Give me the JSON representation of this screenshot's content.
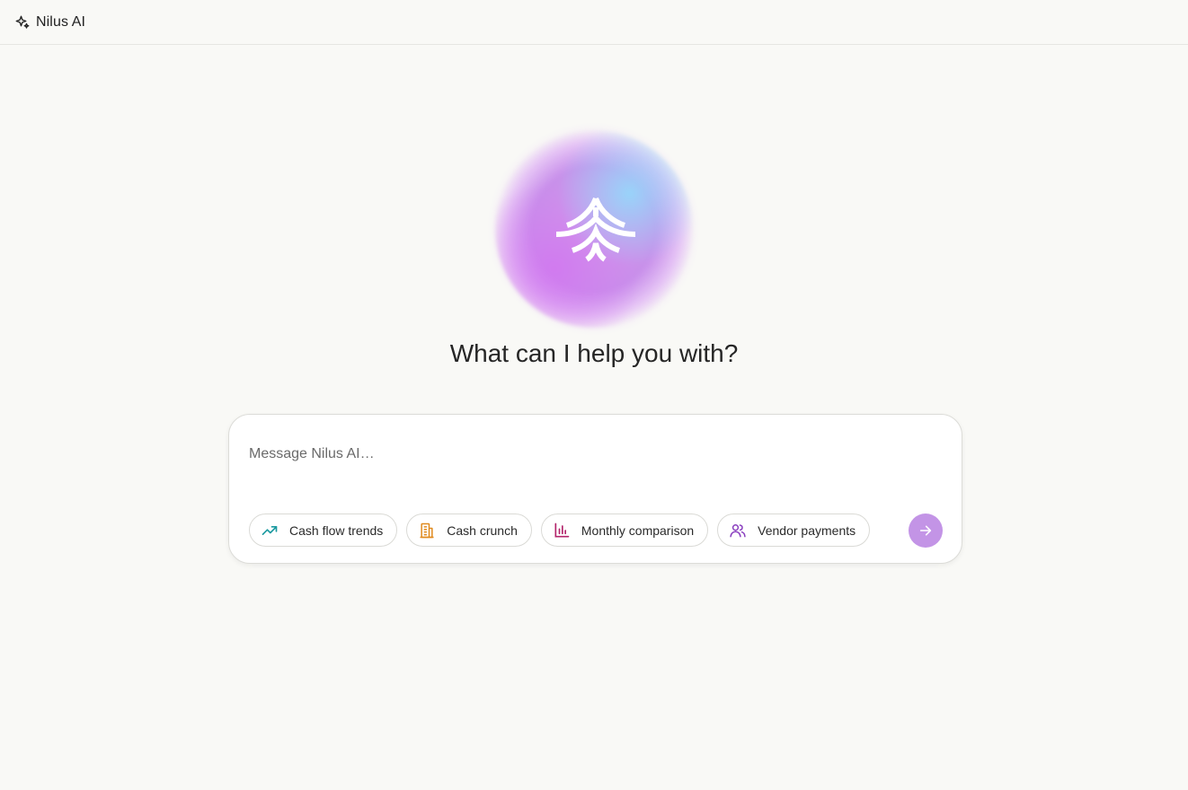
{
  "header": {
    "brand_name": "Nilus AI",
    "brand_icon": "sparkle-icon"
  },
  "hero": {
    "logo_icon": "nilus-logo-icon",
    "headline": "What can I help you with?"
  },
  "composer": {
    "placeholder": "Message Nilus AI…",
    "value": "",
    "suggestions": [
      {
        "label": "Cash flow trends",
        "icon": "trending-up-icon",
        "color": "#1b9aa0"
      },
      {
        "label": "Cash crunch",
        "icon": "building-icon",
        "color": "#e08a1e"
      },
      {
        "label": "Monthly comparison",
        "icon": "bar-chart-icon",
        "color": "#b3246b"
      },
      {
        "label": "Vendor payments",
        "icon": "users-icon",
        "color": "#8a3fbf"
      }
    ],
    "send_icon": "arrow-right-icon"
  },
  "colors": {
    "background": "#f9f9f6",
    "accent": "#c394e6"
  }
}
